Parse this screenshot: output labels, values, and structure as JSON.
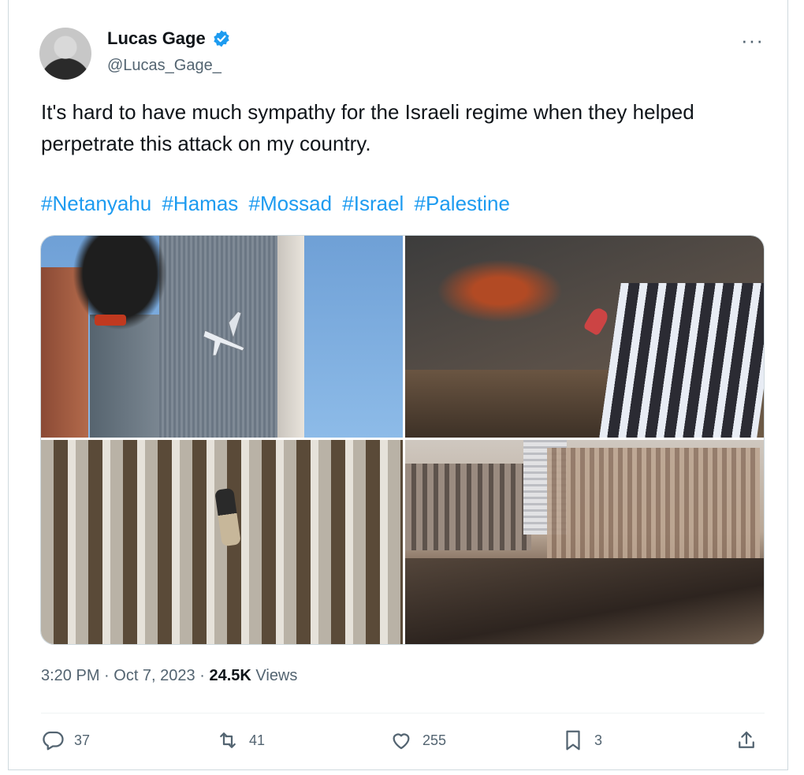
{
  "tweet": {
    "author": {
      "display_name": "Lucas Gage",
      "handle": "@Lucas_Gage_",
      "verified": true
    },
    "text": "It's hard to have much sympathy for the Israeli regime when they helped perpetrate this attack on my country.",
    "hashtags": [
      "#Netanyahu",
      "#Hamas",
      "#Mossad",
      "#Israel",
      "#Palestine"
    ],
    "time": "3:20 PM",
    "date": "Oct 7, 2023",
    "views_count": "24.5K",
    "views_label": "Views",
    "stats": {
      "replies": "37",
      "reposts": "41",
      "likes": "255",
      "bookmarks": "3"
    }
  },
  "icons": {
    "more": "more-options-icon",
    "verified": "verified-badge-icon",
    "reply": "reply-icon",
    "repost": "repost-icon",
    "like": "heart-icon",
    "bookmark": "bookmark-icon",
    "share": "share-icon"
  },
  "colors": {
    "accent": "#1d9bf0",
    "text": "#0f1419",
    "muted": "#536471",
    "border": "#cfd9de"
  }
}
